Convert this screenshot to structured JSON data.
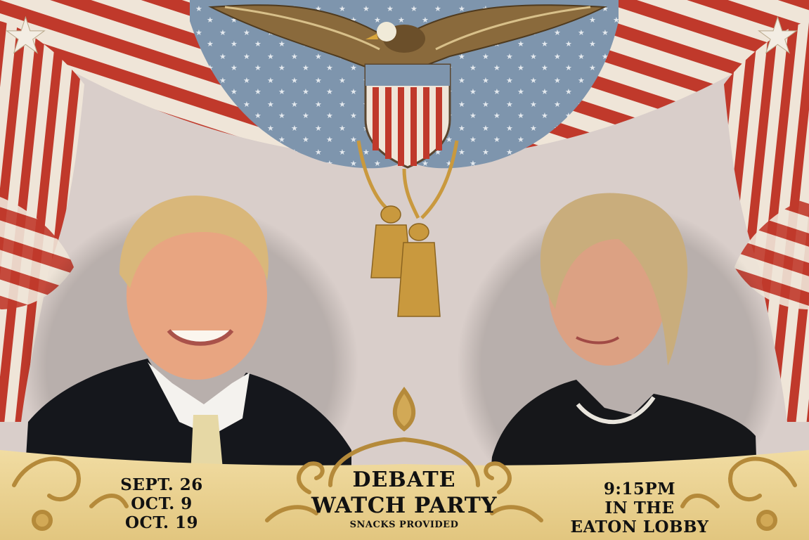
{
  "event": {
    "dates": [
      "SEPT. 26",
      "OCT. 9",
      "OCT. 19"
    ],
    "title_line1": "DEBATE",
    "title_line2": "WATCH PARTY",
    "subtitle": "SNACKS PROVIDED",
    "time": "9:15PM",
    "location_line1": "IN THE",
    "location_line2": "EATON LOBBY"
  },
  "colors": {
    "background": "#d9ceca",
    "banner_gold": "#e8cf8e",
    "ornament_gold": "#b58a3a",
    "flag_red": "#c0392b",
    "flag_blue": "#7e95ad",
    "suit": "#15171c"
  },
  "illustrations": [
    "eagle-emblem",
    "shield-crest",
    "flag-bunting-drapes",
    "gold-tassels",
    "candidate-portrait-left",
    "candidate-portrait-right",
    "baroque-scroll-ornaments"
  ]
}
